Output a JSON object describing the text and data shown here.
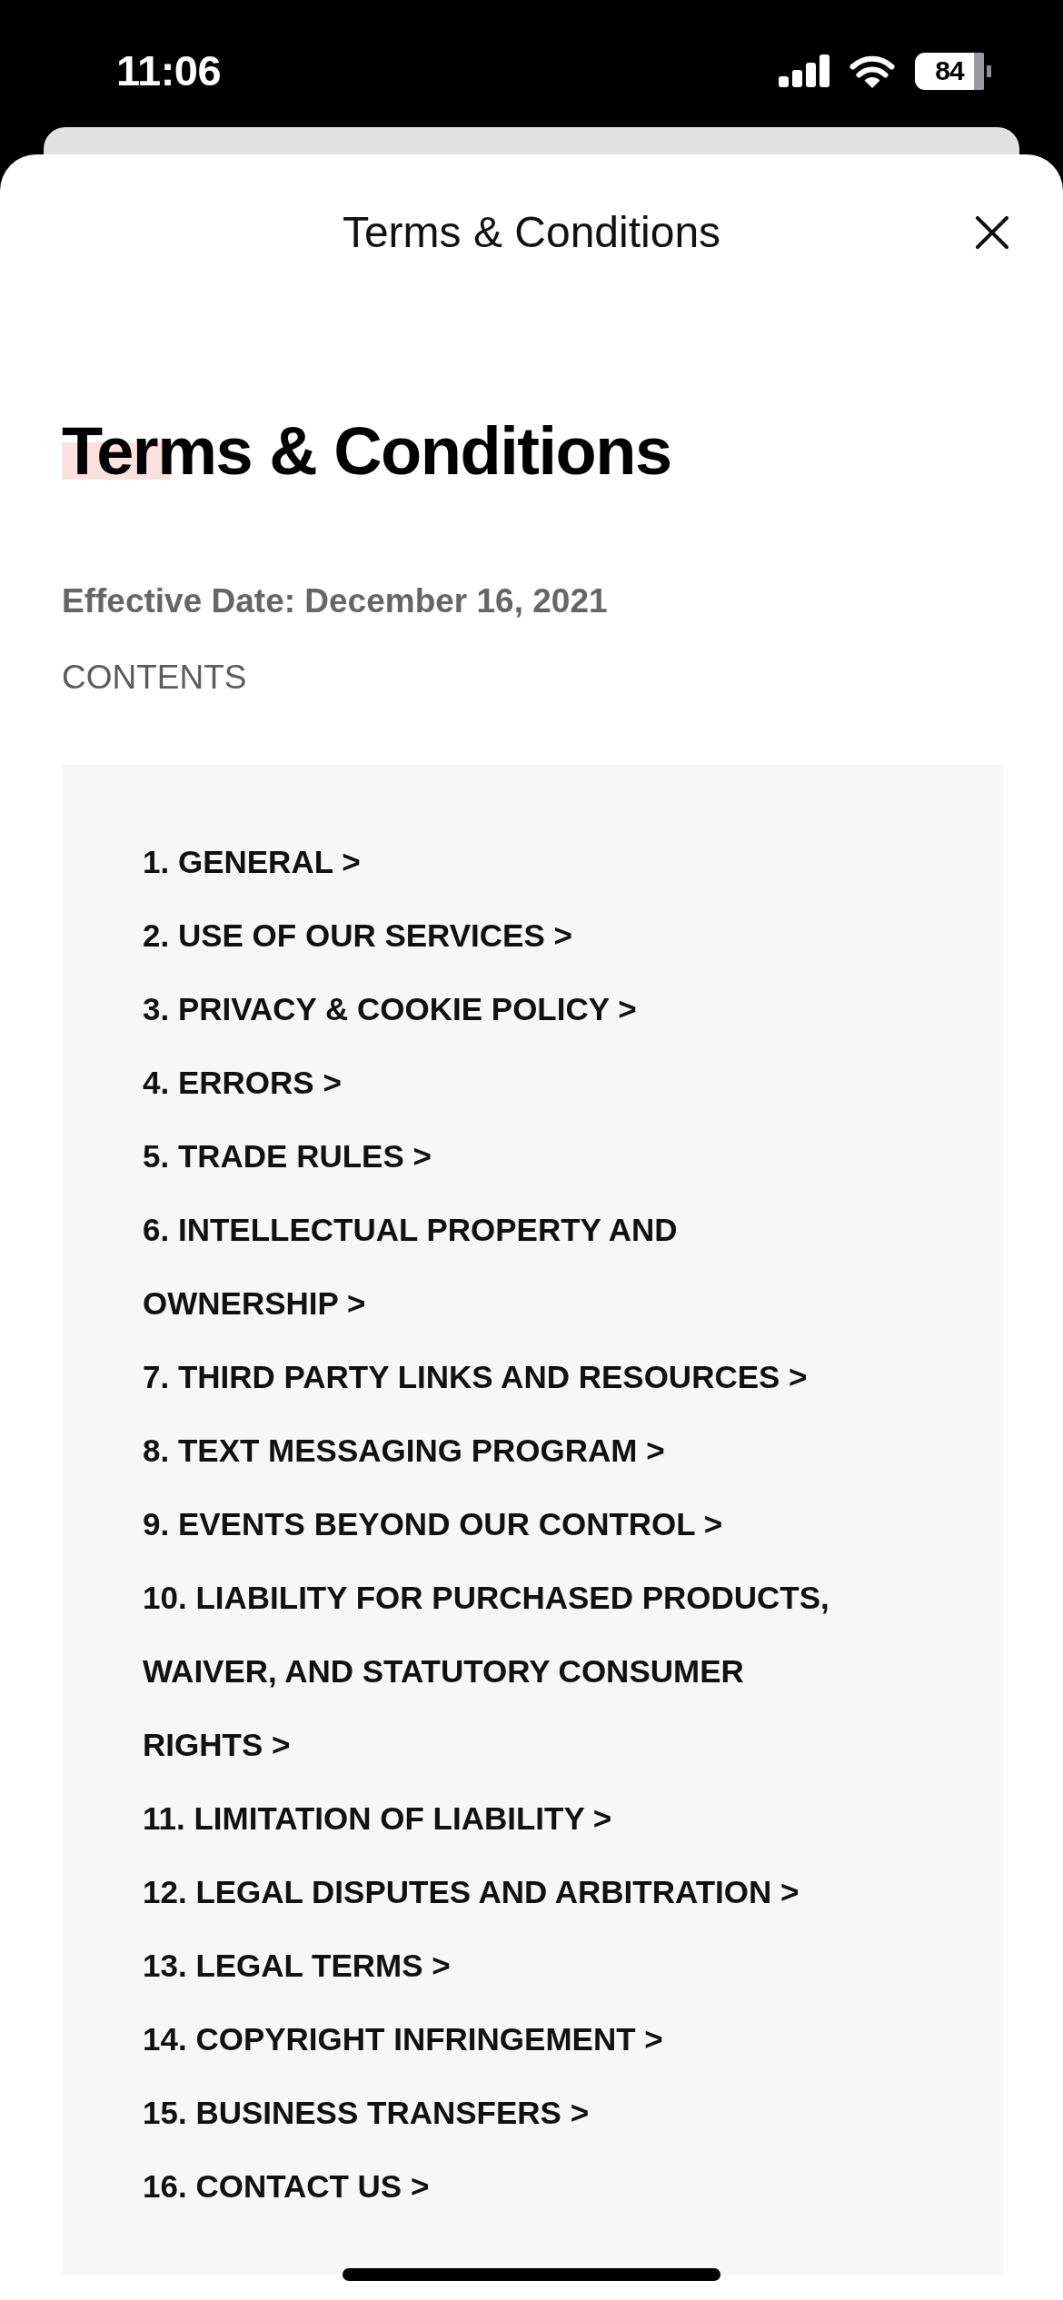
{
  "status_bar": {
    "time": "11:06",
    "battery": "84"
  },
  "sheet": {
    "title": "Terms & Conditions"
  },
  "document": {
    "heading": "Terms & Conditions",
    "effective_date": "Effective Date: December 16, 2021",
    "contents_label": "CONTENTS",
    "contents": [
      "1. GENERAL >",
      "2. USE OF OUR SERVICES >",
      "3. PRIVACY & COOKIE POLICY >",
      "4. ERRORS >",
      "5. TRADE RULES >",
      "6. INTELLECTUAL PROPERTY AND OWNERSHIP >",
      "7. THIRD PARTY LINKS AND RESOURCES >",
      "8. TEXT MESSAGING PROGRAM >",
      "9. EVENTS BEYOND OUR CONTROL >",
      "10. LIABILITY FOR PURCHASED PRODUCTS, WAIVER, AND STATUTORY CONSUMER RIGHTS >",
      "11. LIMITATION OF LIABILITY >",
      "12. LEGAL DISPUTES AND ARBITRATION >",
      "13. LEGAL TERMS >",
      "14. COPYRIGHT INFRINGEMENT >",
      "15. BUSINESS TRANSFERS >",
      "16. CONTACT US >"
    ]
  }
}
